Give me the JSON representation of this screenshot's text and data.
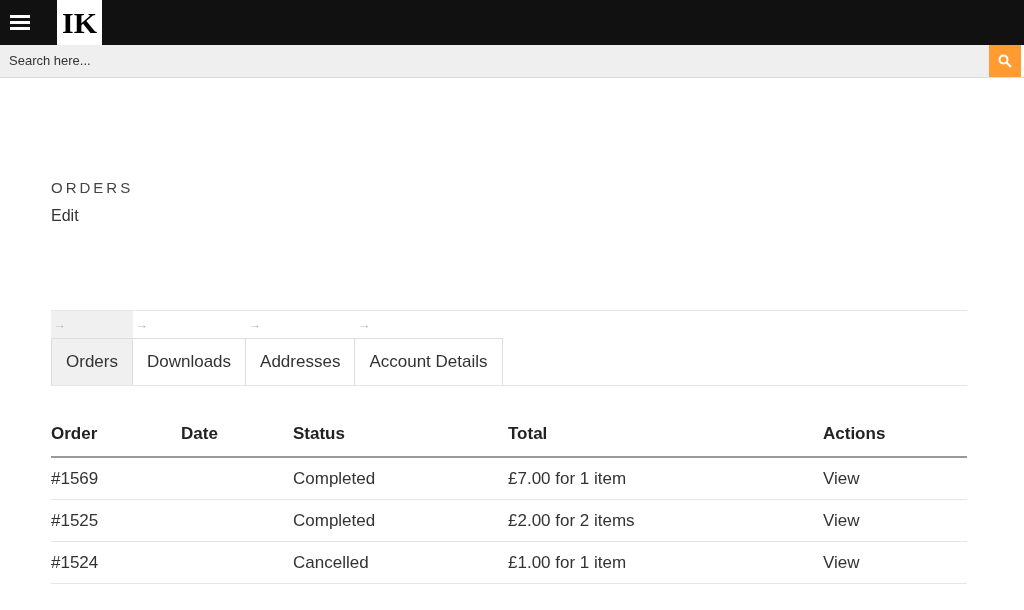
{
  "header": {
    "logo": "IK"
  },
  "search": {
    "placeholder": "Search here..."
  },
  "page": {
    "title": "ORDERS",
    "edit_link": "Edit"
  },
  "tabs": [
    {
      "arrow": "→",
      "label": "Orders",
      "selected": true
    },
    {
      "arrow": "→",
      "label": "Downloads",
      "selected": false
    },
    {
      "arrow": "→",
      "label": "Addresses",
      "selected": false
    },
    {
      "arrow": "→",
      "label": "Account Details",
      "selected": false
    }
  ],
  "table": {
    "columns": [
      "Order",
      "Date",
      "Status",
      "Total",
      "Actions"
    ],
    "rows": [
      {
        "order": "#1569",
        "status": "Completed",
        "total": "£7.00 for 1 item",
        "action": "View"
      },
      {
        "order": "#1525",
        "status": "Completed",
        "total": "£2.00 for 2 items",
        "action": "View"
      },
      {
        "order": "#1524",
        "status": "Cancelled",
        "total": "£1.00 for 1 item",
        "action": "View"
      }
    ]
  }
}
